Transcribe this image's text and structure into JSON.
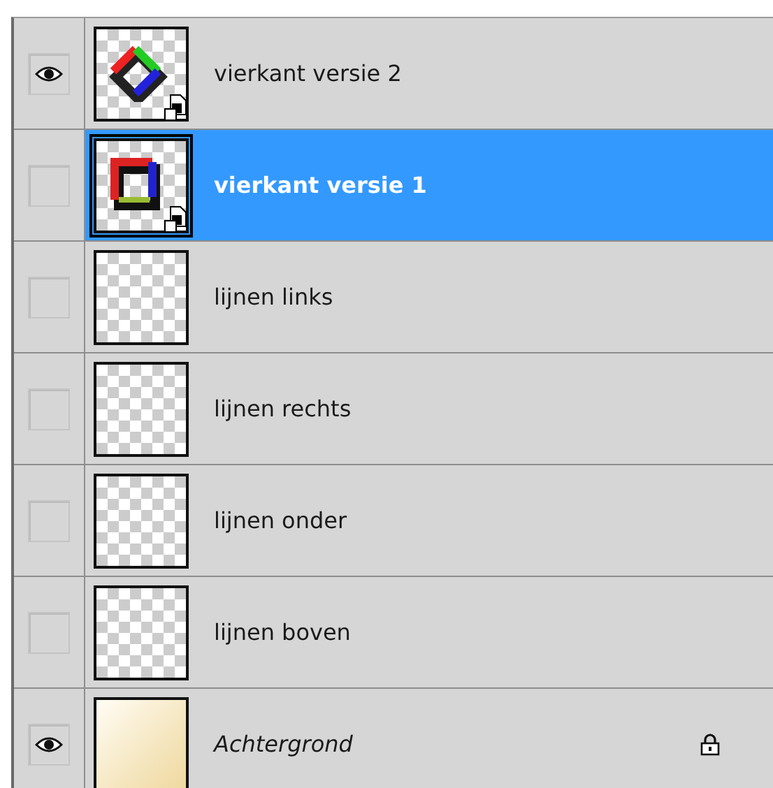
{
  "layers": [
    {
      "name": "vierkant versie 2",
      "visible": true,
      "selected": false,
      "kind": "smart",
      "locked": false
    },
    {
      "name": "vierkant versie 1",
      "visible": false,
      "selected": true,
      "kind": "smart",
      "locked": false
    },
    {
      "name": "lijnen links",
      "visible": false,
      "selected": false,
      "kind": "empty",
      "locked": false
    },
    {
      "name": "lijnen rechts",
      "visible": false,
      "selected": false,
      "kind": "empty",
      "locked": false
    },
    {
      "name": "lijnen onder",
      "visible": false,
      "selected": false,
      "kind": "empty",
      "locked": false
    },
    {
      "name": "lijnen boven",
      "visible": false,
      "selected": false,
      "kind": "empty",
      "locked": false
    },
    {
      "name": "Achtergrond",
      "visible": true,
      "selected": false,
      "kind": "background",
      "locked": true
    }
  ]
}
